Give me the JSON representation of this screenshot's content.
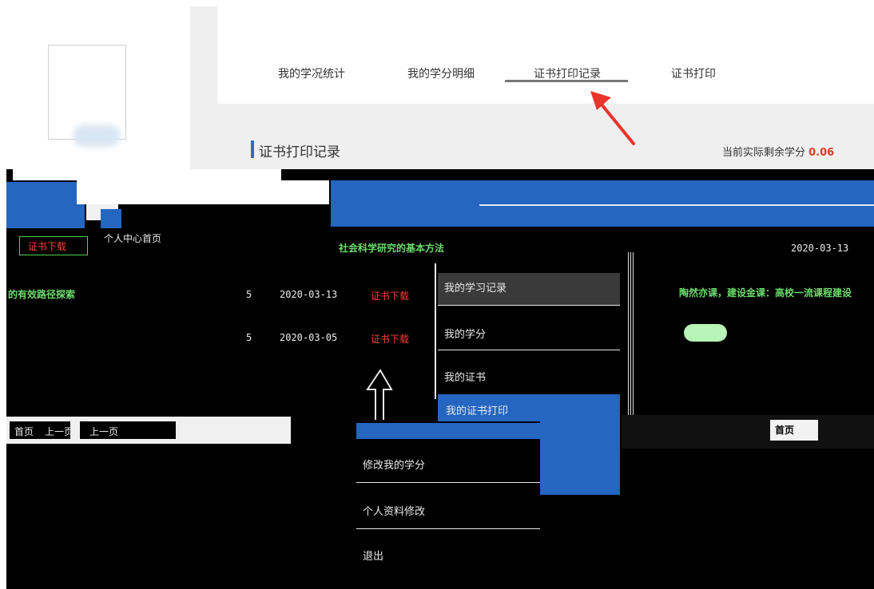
{
  "nav": {
    "tabs": [
      {
        "label": "我的学况统计"
      },
      {
        "label": "我的学分明细"
      },
      {
        "label": "证书打印记录"
      },
      {
        "label": "证书打印"
      }
    ]
  },
  "section": {
    "title": "证书打印记录",
    "credits_label": "当前实际剩余学分",
    "credits_value": "0.06"
  },
  "glitch": {
    "home": "个人中心首页",
    "cert_download": "证书下载",
    "course_title_1": "社会科学研究的基本方法",
    "course_title_2": "的有效路径探索",
    "course_title_3": "陶然亦课，建设金课：高校一流课程建设",
    "credit": "5",
    "date_1": "2020-03-13",
    "date_2": "2020-03-05",
    "menu_items": [
      "我的学习记录",
      "我的学分",
      "我的证书",
      "我的证书打印",
      "修改我的学分",
      "个人资料修改",
      "退出"
    ],
    "home_btn": "首页",
    "prev_btn": "上一页"
  },
  "colors": {
    "accent": "#2f6fbf",
    "credit_value": "#e03b2e",
    "arrow": "#e8342b"
  }
}
